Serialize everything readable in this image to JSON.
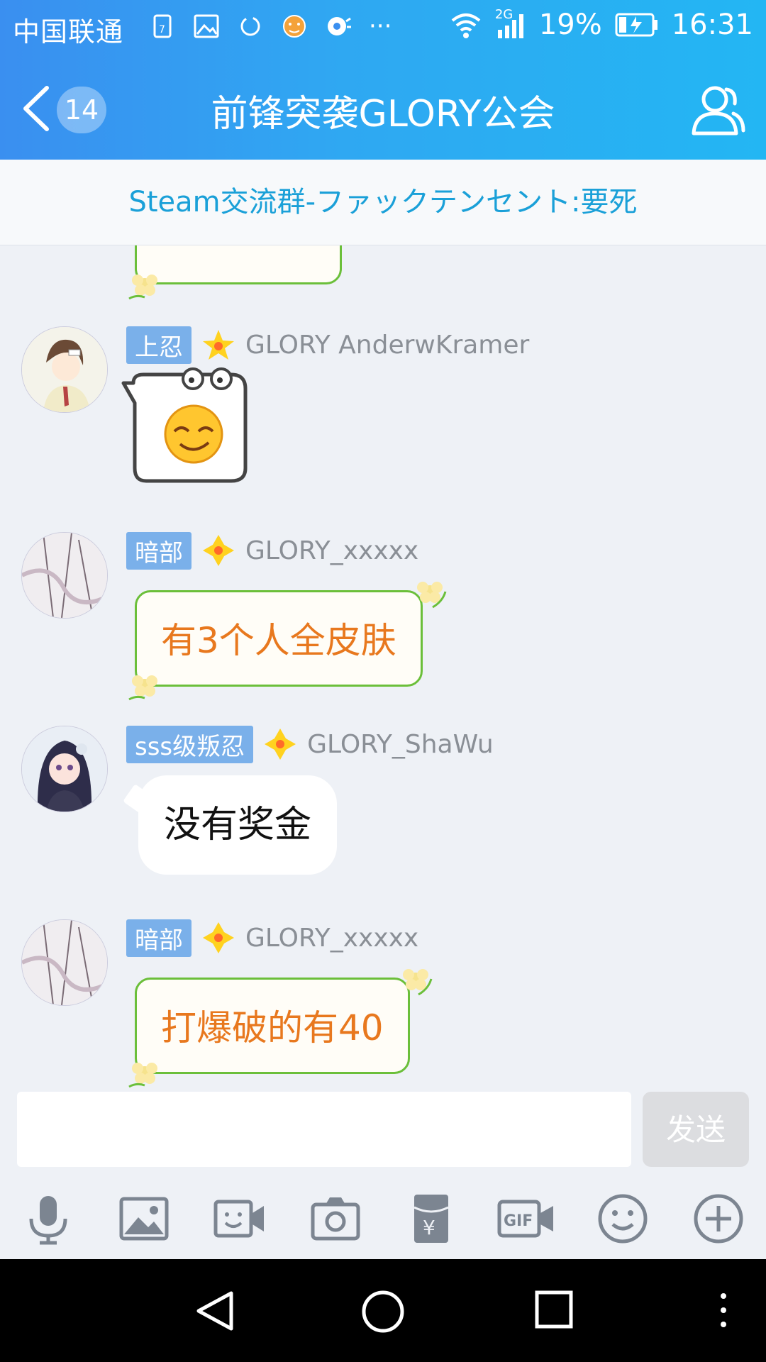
{
  "status_bar": {
    "carrier": "中国联通",
    "network": "2G",
    "battery": "19%",
    "time": "16:31",
    "more": "···"
  },
  "header": {
    "unread_count": "14",
    "title": "前锋突袭GLORY公会"
  },
  "notice": {
    "text": "Steam交流群-ファックテンセント:要死"
  },
  "messages": [
    {
      "role": "上忍",
      "sender": "GLORY AnderwKramer",
      "type": "sticker"
    },
    {
      "role": "暗部",
      "sender": "GLORY_xxxxx",
      "text": "有3个人全皮肤",
      "style": "flower"
    },
    {
      "role": "sss级叛忍",
      "sender": "GLORY_ShaWu",
      "text": "没有奖金",
      "style": "white"
    },
    {
      "role": "暗部",
      "sender": "GLORY_xxxxx",
      "text": "打爆破的有40",
      "style": "flower"
    }
  ],
  "input": {
    "value": "",
    "send_label": "发送"
  },
  "toolbar": [
    "mic-icon",
    "image-icon",
    "video-call-icon",
    "camera-icon",
    "red-packet-icon",
    "gif-icon",
    "emoji-icon",
    "plus-icon"
  ],
  "colors": {
    "header_start": "#3a8ff0",
    "header_end": "#23b6f3",
    "notice_text": "#1aa0d8",
    "flower_text": "#e8781e",
    "flower_border": "#6bbf3a",
    "role_badge": "#7ab0ea"
  }
}
